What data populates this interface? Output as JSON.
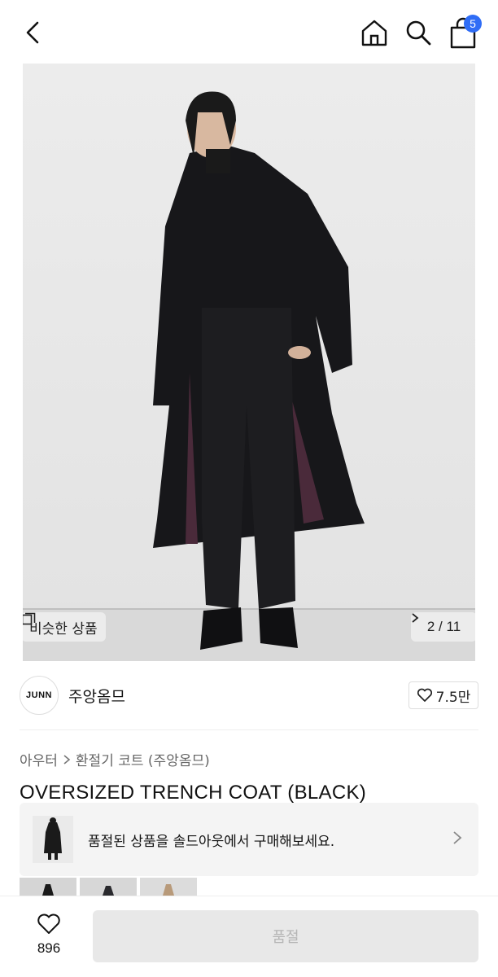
{
  "header": {
    "icons": [
      "back-icon",
      "home-icon",
      "search-icon",
      "shopping-bag-icon"
    ],
    "cart_count": "5"
  },
  "gallery": {
    "similar_label": "비슷한 상품",
    "page_current": "2",
    "page_separator": "/",
    "page_total": "11"
  },
  "brand": {
    "logo_text": "JUNN",
    "name": "주앙옴므",
    "likes": "7.5만"
  },
  "breadcrumb": {
    "category": "아우터",
    "subcategory": "환절기 코트 (주앙옴므)"
  },
  "product": {
    "title": "OVERSIZED TRENCH COAT (BLACK)"
  },
  "soldout_banner": {
    "message": "품절된 상품을 솔드아웃에서 구매해보세요."
  },
  "bottom": {
    "wish_count": "896",
    "buy_label": "품절"
  },
  "colors": {
    "badge": "#2f6df6",
    "disabled_button": "#e8e8e8"
  }
}
